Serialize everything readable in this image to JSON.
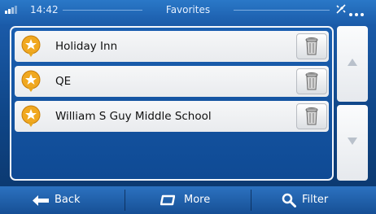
{
  "status": {
    "time": "14:42",
    "title": "Favorites"
  },
  "favorites": [
    {
      "name": "Holiday Inn"
    },
    {
      "name": "QE"
    },
    {
      "name": "William S Guy Middle School"
    }
  ],
  "scroll": {
    "up_icon": "triangle-up-icon",
    "down_icon": "triangle-down-icon"
  },
  "bottom_bar": {
    "back_label": "Back",
    "more_label": "More",
    "filter_label": "Filter"
  },
  "colors": {
    "favorite_star": "#f0a820",
    "accent_blue": "#1a5aa8"
  }
}
